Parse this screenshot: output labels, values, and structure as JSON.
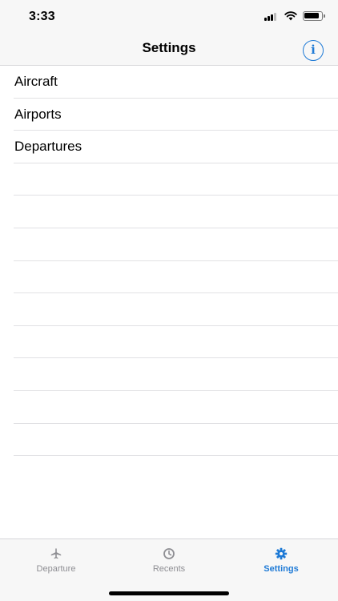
{
  "status_bar": {
    "time": "3:33"
  },
  "nav": {
    "title": "Settings",
    "info_label": "i"
  },
  "list": {
    "items": [
      {
        "label": "Aircraft"
      },
      {
        "label": "Airports"
      },
      {
        "label": "Departures"
      }
    ]
  },
  "tab_bar": {
    "tabs": [
      {
        "label": "Departure",
        "icon": "airplane-icon"
      },
      {
        "label": "Recents",
        "icon": "clock-icon"
      },
      {
        "label": "Settings",
        "icon": "gear-icon",
        "active": true
      }
    ]
  },
  "colors": {
    "accent": "#1e7ad6",
    "inactive": "#8e8e93",
    "separator": "#e1e1e4"
  }
}
